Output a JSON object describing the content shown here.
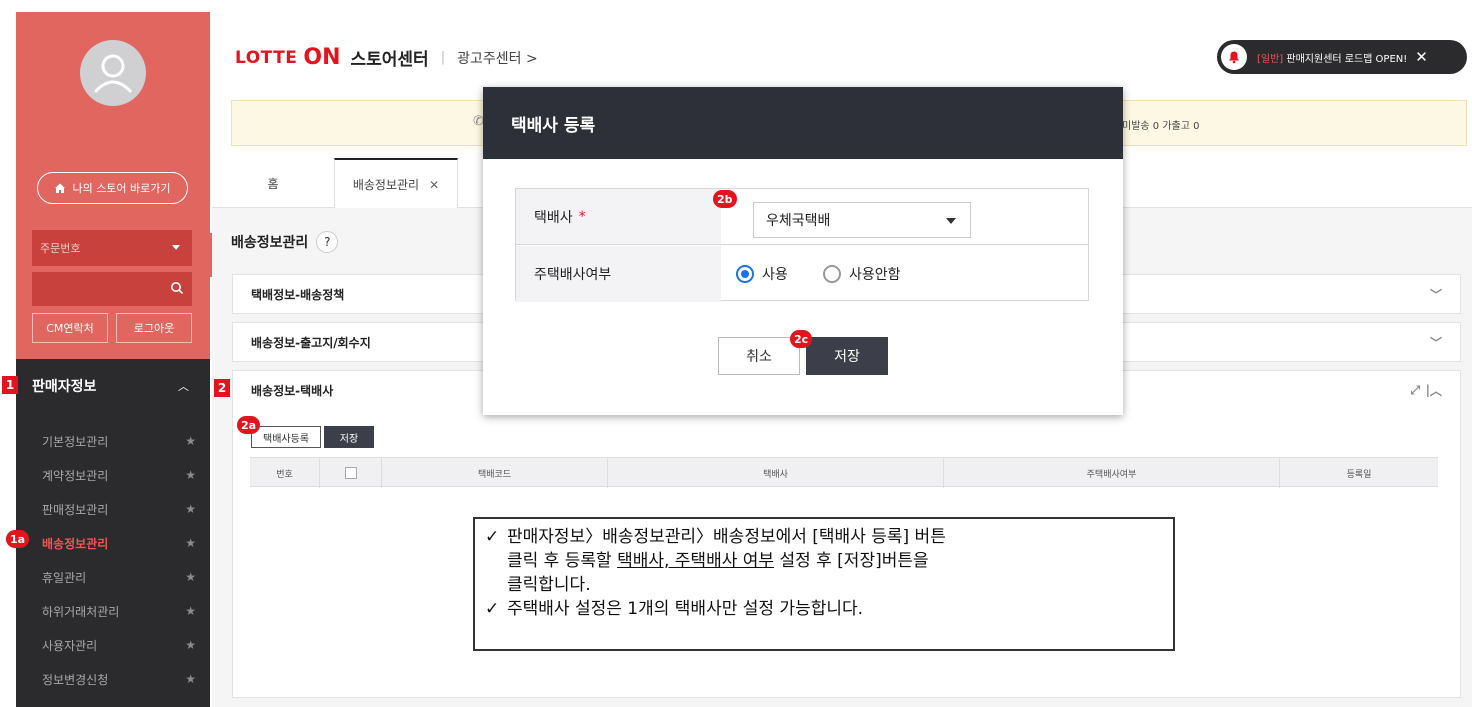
{
  "sidebar": {
    "store_button": "나의 스토어 바로가기",
    "order_select": "주문번호",
    "cm_contact": "CM연락처",
    "logout": "로그아웃",
    "section_title": "판매자정보",
    "menu": [
      {
        "label": "기본정보관리",
        "active": false
      },
      {
        "label": "계약정보관리",
        "active": false
      },
      {
        "label": "판매정보관리",
        "active": false
      },
      {
        "label": "배송정보관리",
        "active": true
      },
      {
        "label": "휴일관리",
        "active": false
      },
      {
        "label": "하위거래처관리",
        "active": false
      },
      {
        "label": "사용자관리",
        "active": false
      },
      {
        "label": "정보변경신청",
        "active": false
      }
    ]
  },
  "header": {
    "logo_lotte": "LOTTE",
    "logo_on": "ON",
    "store_center": "스토어센터",
    "ad_center": "광고주센터 >",
    "notice_tag": "[일반]",
    "notice_text": "판매지원센터 로드맵 OPEN!"
  },
  "yellow_bar": {
    "stats": "미발송 0   가출고 0"
  },
  "tabs": [
    {
      "label": "홈"
    },
    {
      "label": "배송정보관리"
    }
  ],
  "page": {
    "title": "배송정보관리",
    "help": "?",
    "sections": [
      {
        "label": "택배정보-배송정책"
      },
      {
        "label": "배송정보-출고지/회수지"
      },
      {
        "label": "배송정보-택배사"
      }
    ],
    "register_button": "택배사등록",
    "save_button": "저장",
    "table_headers": [
      "번호",
      "",
      "택배코드",
      "택배사",
      "주택배사여부",
      "등록일"
    ]
  },
  "modal": {
    "title": "택배사 등록",
    "courier_label": "택배사",
    "required_mark": "*",
    "courier_value": "우체국택배",
    "main_label": "주택배사여부",
    "radio_use": "사용",
    "radio_unused": "사용안함",
    "cancel": "취소",
    "save": "저장"
  },
  "badges": {
    "b1": "1",
    "b1a": "1a",
    "b2": "2",
    "b2a": "2a",
    "b2b": "2b",
    "b2c": "2c"
  },
  "callout": {
    "line1": "판매자정보〉배송정보관리〉배송정보에서 [택배사 등록] 버튼",
    "line2_a": "클릭 후 등록할 ",
    "line2_u": "택배사, 주택배사 여부",
    "line2_b": " 설정 후 [저장]버튼을",
    "line3": "클릭합니다.",
    "line4": "주택배사 설정은 1개의 택배사만 설정 가능합니다."
  },
  "colors": {
    "brand_red": "#e4141e",
    "sidebar_top": "#e16660",
    "sidebar_dark": "#2b2b2d",
    "modal_header": "#2e3039",
    "radio_blue": "#1a73e8"
  }
}
